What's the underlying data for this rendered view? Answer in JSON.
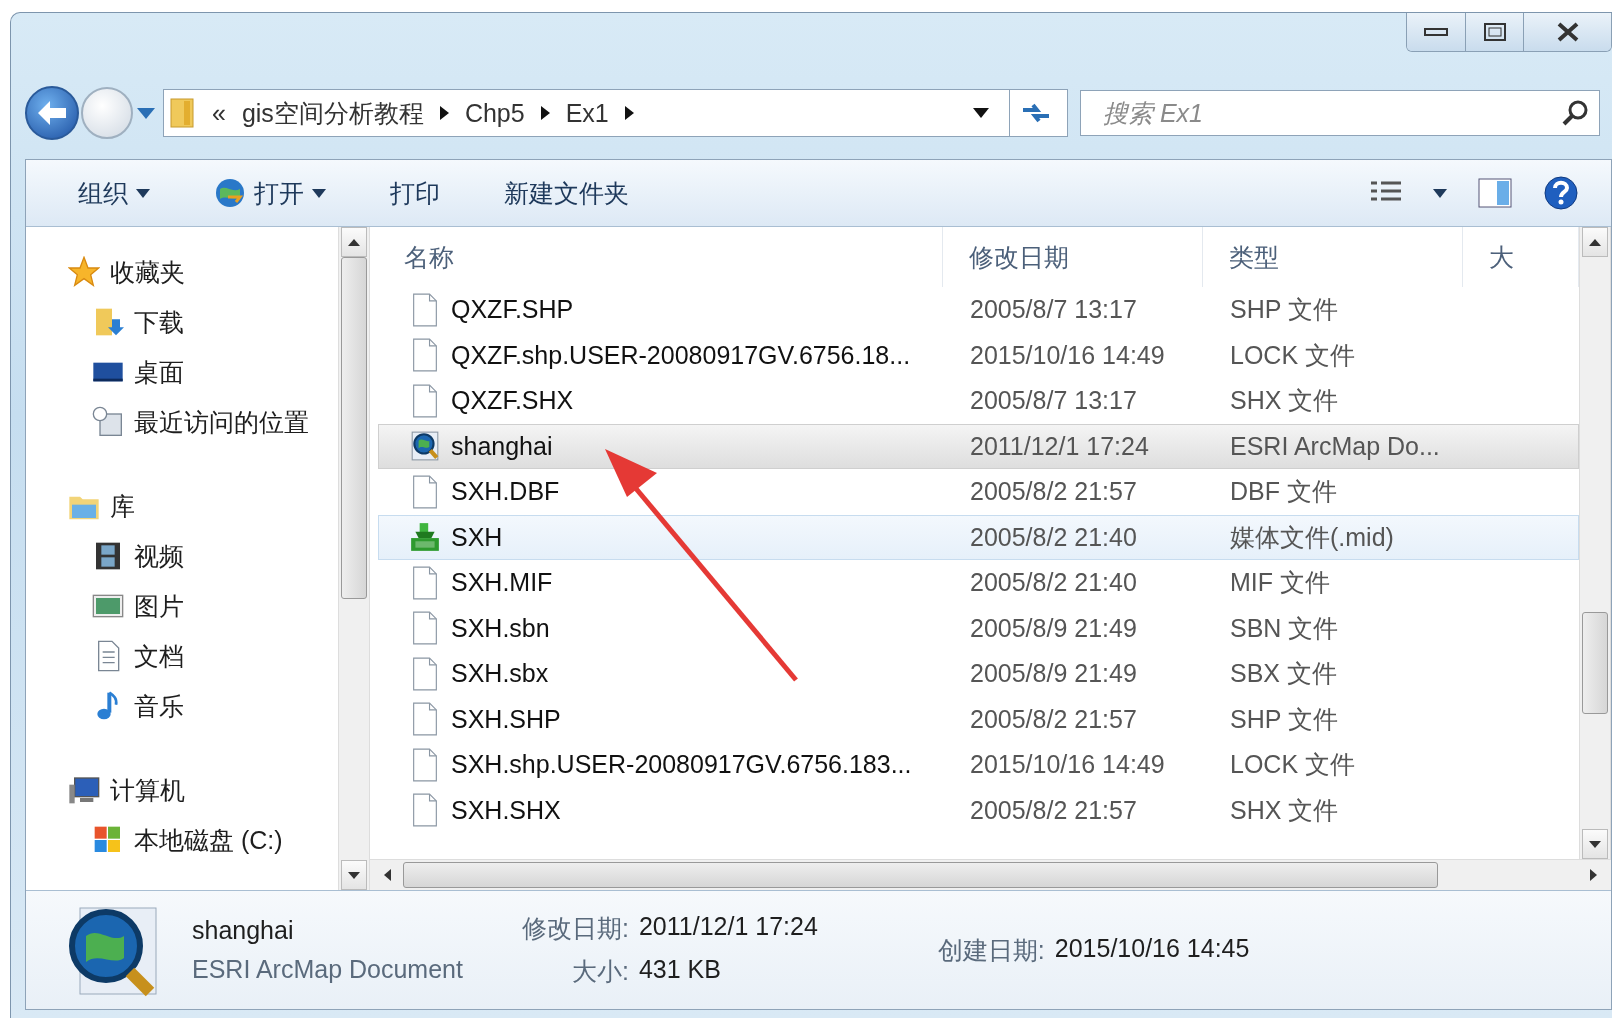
{
  "address_bar": {
    "overflow": "«",
    "path": [
      {
        "label": "gis空间分析教程"
      },
      {
        "label": "Chp5"
      },
      {
        "label": "Ex1"
      }
    ]
  },
  "search": {
    "placeholder": "搜索 Ex1"
  },
  "toolbar": [
    {
      "label": "组织",
      "dropdown": true,
      "kind": "plain"
    },
    {
      "label": "打开",
      "dropdown": true,
      "kind": "open"
    },
    {
      "label": "打印",
      "dropdown": false,
      "kind": "plain"
    },
    {
      "label": "新建文件夹",
      "dropdown": false,
      "kind": "plain"
    }
  ],
  "navigation": [
    {
      "label": "收藏夹",
      "kind": "star",
      "children": [
        {
          "label": "下载",
          "kind": "download"
        },
        {
          "label": "桌面",
          "kind": "desktop"
        },
        {
          "label": "最近访问的位置",
          "kind": "recent"
        }
      ]
    },
    {
      "label": "库",
      "kind": "library",
      "children": [
        {
          "label": "视频",
          "kind": "video"
        },
        {
          "label": "图片",
          "kind": "picture"
        },
        {
          "label": "文档",
          "kind": "document"
        },
        {
          "label": "音乐",
          "kind": "music"
        }
      ]
    },
    {
      "label": "计算机",
      "kind": "computer",
      "children": [
        {
          "label": "本地磁盘 (C:)",
          "kind": "drive"
        }
      ]
    }
  ],
  "file_list": {
    "columns": [
      "名称",
      "修改日期",
      "类型",
      "大"
    ],
    "rows": [
      {
        "name": "QXZF.SHP",
        "date": "2005/8/7 13:17",
        "type": "SHP 文件",
        "kind": "file",
        "selected": false,
        "hot": false
      },
      {
        "name": "QXZF.shp.USER-20080917GV.6756.18...",
        "date": "2015/10/16 14:49",
        "type": "LOCK 文件",
        "kind": "file",
        "selected": false,
        "hot": false
      },
      {
        "name": "QXZF.SHX",
        "date": "2005/8/7 13:17",
        "type": "SHX 文件",
        "kind": "file",
        "selected": false,
        "hot": false
      },
      {
        "name": "shanghai",
        "date": "2011/12/1 17:24",
        "type": "ESRI ArcMap Do...",
        "kind": "arcmap",
        "selected": true,
        "hot": false
      },
      {
        "name": "SXH.DBF",
        "date": "2005/8/2 21:57",
        "type": "DBF 文件",
        "kind": "file",
        "selected": false,
        "hot": false
      },
      {
        "name": "SXH",
        "date": "2005/8/2 21:40",
        "type": "媒体文件(.mid)",
        "kind": "midi",
        "selected": false,
        "hot": true
      },
      {
        "name": "SXH.MIF",
        "date": "2005/8/2 21:40",
        "type": "MIF 文件",
        "kind": "file",
        "selected": false,
        "hot": false
      },
      {
        "name": "SXH.sbn",
        "date": "2005/8/9 21:49",
        "type": "SBN 文件",
        "kind": "file",
        "selected": false,
        "hot": false
      },
      {
        "name": "SXH.sbx",
        "date": "2005/8/9 21:49",
        "type": "SBX 文件",
        "kind": "file",
        "selected": false,
        "hot": false
      },
      {
        "name": "SXH.SHP",
        "date": "2005/8/2 21:57",
        "type": "SHP 文件",
        "kind": "file",
        "selected": false,
        "hot": false
      },
      {
        "name": "SXH.shp.USER-20080917GV.6756.183...",
        "date": "2015/10/16 14:49",
        "type": "LOCK 文件",
        "kind": "file",
        "selected": false,
        "hot": false
      },
      {
        "name": "SXH.SHX",
        "date": "2005/8/2 21:57",
        "type": "SHX 文件",
        "kind": "file",
        "selected": false,
        "hot": false
      }
    ]
  },
  "details": {
    "name": "shanghai",
    "type": "ESRI ArcMap Document",
    "fields": [
      {
        "label": "修改日期:",
        "value": "2011/12/1 17:24"
      },
      {
        "label": "大小:",
        "value": "431 KB"
      },
      {
        "label": "创建日期:",
        "value": "2015/10/16 14:45"
      }
    ]
  }
}
